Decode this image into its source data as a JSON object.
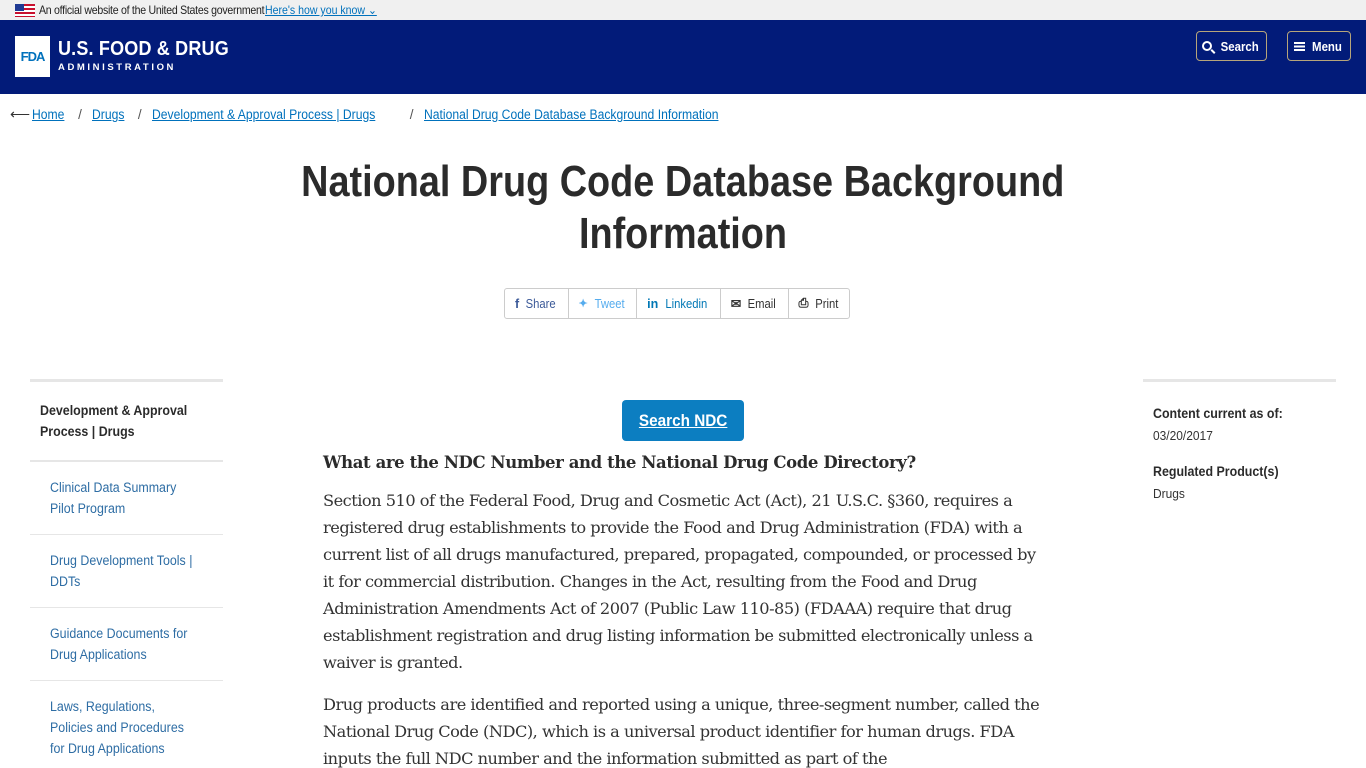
{
  "gov_banner": {
    "text": "An official website of the United States government",
    "link": "Here's how you know ⌄"
  },
  "header": {
    "logo": "FDA",
    "title": "U.S. FOOD & DRUG",
    "subtitle": "ADMINISTRATION",
    "search_label": "Search",
    "menu_label": "Menu"
  },
  "breadcrumb": [
    {
      "label": "Home"
    },
    {
      "label": "Drugs"
    },
    {
      "label": "Development & Approval Process | Drugs"
    },
    {
      "label": "National Drug Code Database Background Information"
    }
  ],
  "page": {
    "title_line1": "National Drug Code Database Background",
    "title_line2": "Information"
  },
  "share": [
    {
      "icon": "facebook-icon",
      "glyph": "f",
      "label": "Share"
    },
    {
      "icon": "twitter-icon",
      "glyph": "🐦",
      "label": "Tweet"
    },
    {
      "icon": "linkedin-icon",
      "glyph": "in",
      "label": "Linkedin"
    },
    {
      "icon": "email-icon",
      "glyph": "✉",
      "label": "Email"
    },
    {
      "icon": "print-icon",
      "glyph": "⎙",
      "label": "Print"
    }
  ],
  "sidebar": {
    "heading": "Development & Approval Process | Drugs",
    "items": [
      {
        "label": "Clinical Data Summary Pilot Program"
      },
      {
        "label": "Drug Development Tools | DDTs"
      },
      {
        "label": "Guidance Documents for Drug Applications"
      },
      {
        "label": "Laws, Regulations, Policies and Procedures for Drug Applications"
      }
    ]
  },
  "rail": {
    "content_current_label": "Content current as of:",
    "content_current_value": "03/20/2017",
    "regulated_label": "Regulated Product(s)",
    "regulated_value": "Drugs"
  },
  "content": {
    "button": "Search NDC",
    "heading": "What are the NDC Number and the National Drug Code Directory?",
    "paragraphs": [
      "Section 510 of the Federal Food, Drug and Cosmetic Act (Act), 21 U.S.C. §360, requires a registered drug establishments to provide the Food and Drug Administration (FDA) with a current list of all drugs manufactured, prepared, propagated, compounded, or processed by it for commercial distribution. Changes in the Act, resulting from the Food and Drug Administration Amendments Act of 2007 (Public Law 110-85) (FDAAA) require that drug establishment registration and drug listing information be submitted electronically unless a waiver is granted.",
      "Drug products are identified and reported using a unique, three-segment number, called the National Drug Code (NDC), which is a universal product identifier for human drugs. FDA inputs the full NDC number and the information submitted as part of the"
    ]
  }
}
